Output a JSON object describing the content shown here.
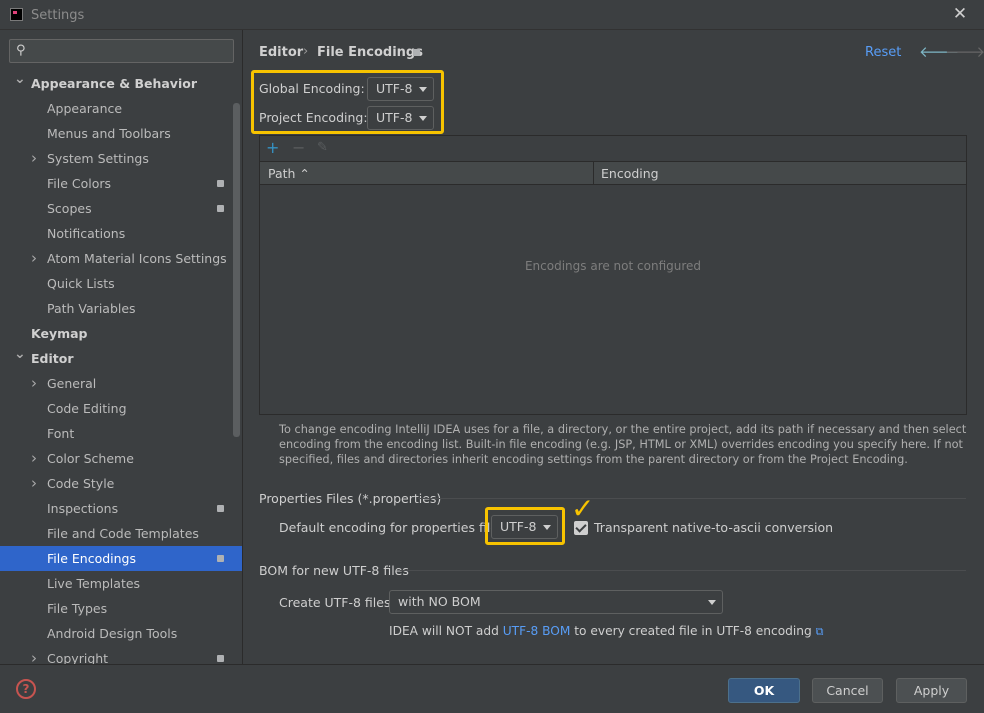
{
  "window": {
    "title": "Settings"
  },
  "search": {
    "placeholder": ""
  },
  "sidebar": {
    "items": [
      {
        "label": "Appearance & Behavior",
        "level": 0,
        "bold": true,
        "expand": "expanded"
      },
      {
        "label": "Appearance",
        "level": 1
      },
      {
        "label": "Menus and Toolbars",
        "level": 1
      },
      {
        "label": "System Settings",
        "level": 1,
        "expand": "collapsed"
      },
      {
        "label": "File Colors",
        "level": 1,
        "badge": true
      },
      {
        "label": "Scopes",
        "level": 1,
        "badge": true
      },
      {
        "label": "Notifications",
        "level": 1
      },
      {
        "label": "Atom Material Icons Settings",
        "level": 1,
        "expand": "collapsed"
      },
      {
        "label": "Quick Lists",
        "level": 1
      },
      {
        "label": "Path Variables",
        "level": 1
      },
      {
        "label": "Keymap",
        "level": 0,
        "bold": true
      },
      {
        "label": "Editor",
        "level": 0,
        "bold": true,
        "expand": "expanded"
      },
      {
        "label": "General",
        "level": 1,
        "expand": "collapsed"
      },
      {
        "label": "Code Editing",
        "level": 1
      },
      {
        "label": "Font",
        "level": 1
      },
      {
        "label": "Color Scheme",
        "level": 1,
        "expand": "collapsed"
      },
      {
        "label": "Code Style",
        "level": 1,
        "expand": "collapsed"
      },
      {
        "label": "Inspections",
        "level": 1,
        "badge": true
      },
      {
        "label": "File and Code Templates",
        "level": 1
      },
      {
        "label": "File Encodings",
        "level": 1,
        "badge": true,
        "selected": true
      },
      {
        "label": "Live Templates",
        "level": 1
      },
      {
        "label": "File Types",
        "level": 1
      },
      {
        "label": "Android Design Tools",
        "level": 1
      },
      {
        "label": "Copyright",
        "level": 1,
        "badge": true,
        "expand": "collapsed"
      }
    ]
  },
  "breadcrumb": {
    "parent": "Editor",
    "separator": "›",
    "current": "File Encodings"
  },
  "header": {
    "reset_label": "Reset"
  },
  "encoding": {
    "global_label": "Global Encoding:",
    "global_value": "UTF-8",
    "project_label": "Project Encoding:",
    "project_value": "UTF-8"
  },
  "table": {
    "toolbar": {
      "add": "+",
      "remove": "−",
      "edit": "✎"
    },
    "columns": [
      "Path ⌃",
      "Encoding"
    ],
    "empty_text": "Encodings are not configured"
  },
  "hint": "To change encoding IntelliJ IDEA uses for a file, a directory, or the entire project, add its path if necessary and then select encoding from the encoding list. Built-in file encoding (e.g. JSP, HTML or XML) overrides encoding you specify here. If not specified, files and directories inherit encoding settings from the parent directory or from the Project Encoding.",
  "properties": {
    "section_title": "Properties Files (*.properties)",
    "default_label": "Default encoding for properties files:",
    "default_value": "UTF-8",
    "transparent_label": "Transparent native-to-ascii conversion",
    "transparent_checked": true
  },
  "bom": {
    "section_title": "BOM for new UTF-8 files",
    "create_label": "Create UTF-8 files:",
    "create_value": "with NO BOM",
    "note_prefix": "IDEA will NOT add ",
    "note_link": "UTF-8 BOM",
    "note_suffix": " to every created file in UTF-8 encoding"
  },
  "footer": {
    "help": "?",
    "ok": "OK",
    "cancel": "Cancel",
    "apply": "Apply"
  },
  "colors": {
    "background": "#3c3f41",
    "selection": "#2f65ca",
    "link": "#589df6",
    "highlight": "#f7c300",
    "primary_button": "#365880"
  },
  "annotation": {
    "checkmark": "✓"
  }
}
